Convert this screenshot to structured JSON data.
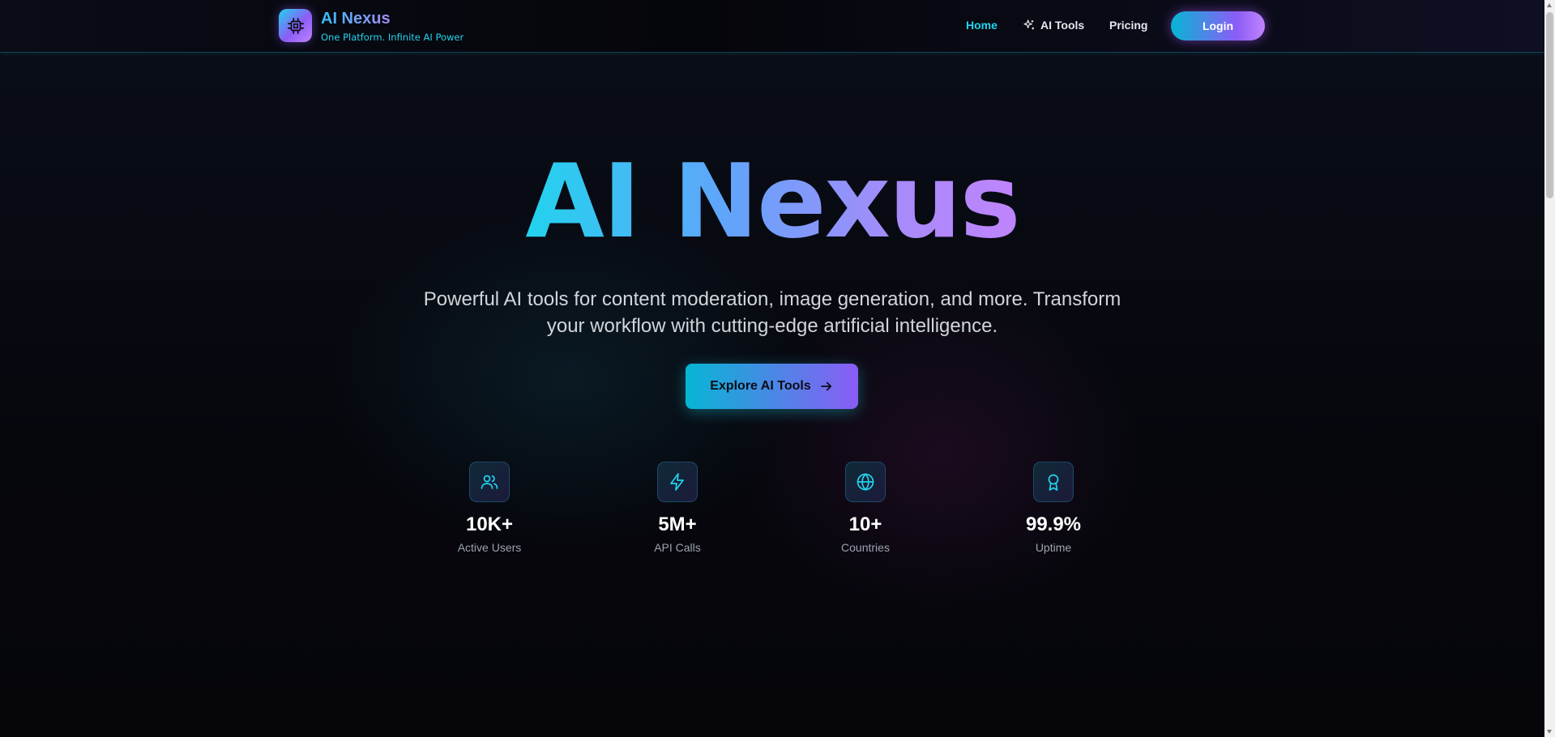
{
  "nav": {
    "brand_title": "AI Nexus",
    "brand_subtitle": "One Platform. Infinite AI Power",
    "brand_icon": "cpu-chip-icon",
    "links": [
      {
        "label": "Home",
        "active": true
      },
      {
        "label": "AI Tools",
        "icon": "sparkles-icon"
      },
      {
        "label": "Pricing"
      }
    ],
    "login_label": "Login"
  },
  "hero": {
    "title": "AI Nexus",
    "description": "Powerful AI tools for content moderation, image generation, and more. Transform your workflow with cutting-edge artificial intelligence.",
    "cta_label": "Explore AI Tools",
    "cta_icon": "arrow-right-icon"
  },
  "stats": [
    {
      "value": "10K+",
      "label": "Active Users",
      "icon": "users-icon"
    },
    {
      "value": "5M+",
      "label": "API Calls",
      "icon": "lightning-icon"
    },
    {
      "value": "10+",
      "label": "Countries",
      "icon": "globe-icon"
    },
    {
      "value": "99.9%",
      "label": "Uptime",
      "icon": "award-icon"
    }
  ],
  "colors": {
    "accent_cyan": "#22d3ee",
    "accent_purple": "#a78bfa",
    "accent_pink": "#c084fc",
    "background": "#06070d"
  }
}
